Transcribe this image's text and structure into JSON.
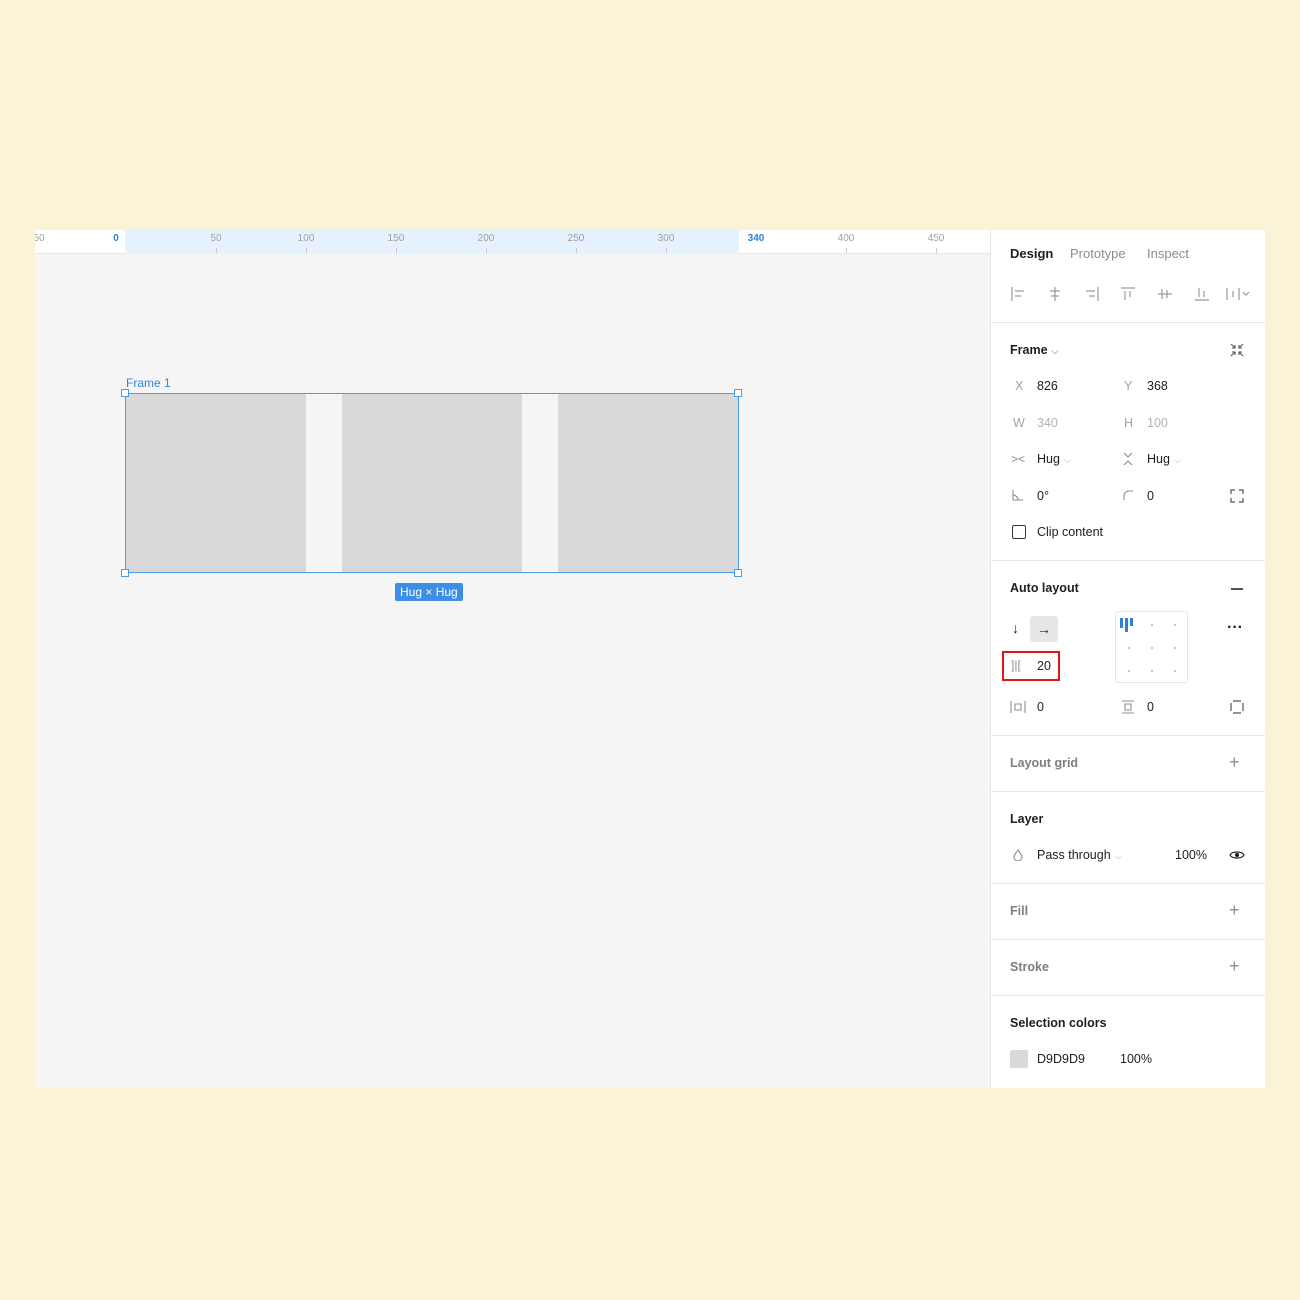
{
  "ruler": {
    "ticks": [
      "50",
      "0",
      "50",
      "100",
      "150",
      "200",
      "250",
      "300",
      "340",
      "400",
      "450"
    ],
    "selection_start": "0",
    "selection_end": "340"
  },
  "canvas": {
    "frame_label": "Frame 1",
    "size_badge": "Hug × Hug",
    "child_fill": "#D9D9D9"
  },
  "tabs": [
    {
      "label": "Design",
      "active": true
    },
    {
      "label": "Prototype",
      "active": false
    },
    {
      "label": "Inspect",
      "active": false
    }
  ],
  "alignment_icons": [
    "align-left-icon",
    "align-horizontal-center-icon",
    "align-right-icon",
    "align-top-icon",
    "align-vertical-center-icon",
    "align-bottom-icon",
    "distribute-icon"
  ],
  "frame": {
    "title": "Frame",
    "x_label": "X",
    "x_value": "826",
    "y_label": "Y",
    "y_value": "368",
    "w_label": "W",
    "w_value": "340",
    "h_label": "H",
    "h_value": "100",
    "width_mode": "Hug",
    "height_mode": "Hug",
    "rotation": "0°",
    "radius": "0",
    "clip_label": "Clip content",
    "clip_checked": false
  },
  "auto_layout": {
    "title": "Auto layout",
    "direction": "horizontal",
    "gap": "20",
    "padding_horizontal": "0",
    "padding_vertical": "0",
    "alignment": "top-left"
  },
  "layout_grid": {
    "title": "Layout grid"
  },
  "layer": {
    "title": "Layer",
    "blend": "Pass through",
    "opacity": "100%"
  },
  "fill": {
    "title": "Fill"
  },
  "stroke": {
    "title": "Stroke"
  },
  "selection_colors": {
    "title": "Selection colors",
    "hex": "D9D9D9",
    "opacity": "100%",
    "swatch": "#D9D9D9"
  },
  "colors": {
    "accent": "#2F80D8",
    "highlight": "#E2141A",
    "background": "#FBF3D7"
  }
}
